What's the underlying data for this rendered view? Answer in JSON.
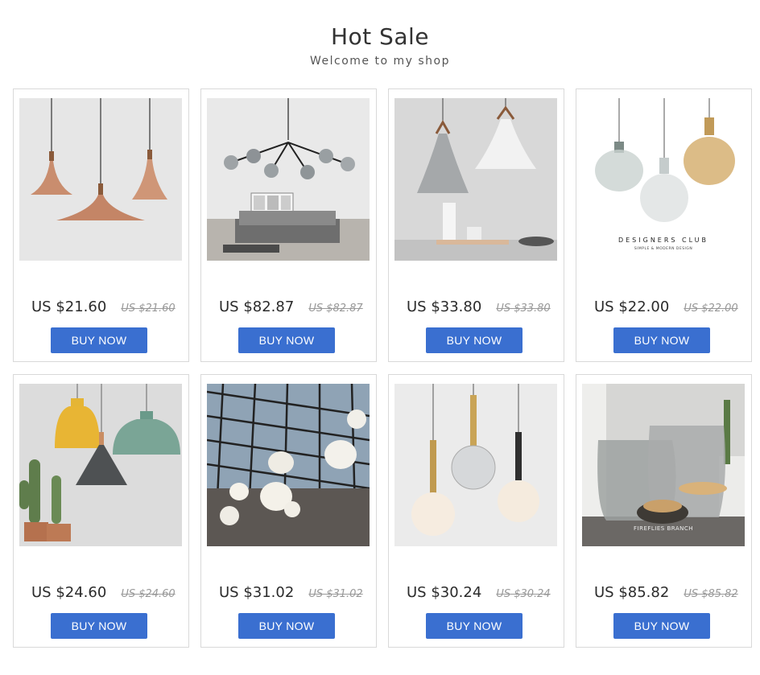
{
  "header": {
    "title": "Hot Sale",
    "subtitle": "Welcome to my shop"
  },
  "products": [
    {
      "name": "Copper cone pendant lamps",
      "price": "US $21.60",
      "old_price": "US $21.60",
      "buy_label": "BUY NOW"
    },
    {
      "name": "Glass globe branch chandelier",
      "price": "US $82.87",
      "old_price": "US $82.87",
      "buy_label": "BUY NOW"
    },
    {
      "name": "White and grey cone pendant lamps",
      "price": "US $33.80",
      "old_price": "US $33.80",
      "buy_label": "BUY NOW"
    },
    {
      "name": "Glass bulb pendant lamps",
      "price": "US $22.00",
      "old_price": "US $22.00",
      "buy_label": "BUY NOW",
      "image_text": {
        "brand": "DESIGNERS CLUB",
        "tagline": "SIMPLE & MODERN DESIGN"
      }
    },
    {
      "name": "Colorful dome pendant lamps",
      "price": "US $24.60",
      "old_price": "US $24.60",
      "buy_label": "BUY NOW"
    },
    {
      "name": "Frosted glass pebble lights",
      "price": "US $31.02",
      "old_price": "US $31.02",
      "buy_label": "BUY NOW"
    },
    {
      "name": "Brass globe pendant lamps",
      "price": "US $30.24",
      "old_price": "US $30.24",
      "buy_label": "BUY NOW"
    },
    {
      "name": "Smoked glass candle holders",
      "price": "US $85.82",
      "old_price": "US $85.82",
      "buy_label": "BUY NOW",
      "image_text": {
        "brand": "FIREFLIES BRANCH"
      }
    }
  ],
  "colors": {
    "buy_button": "#3a6fd0",
    "card_border": "#d9d9d9",
    "old_price": "#999999"
  }
}
